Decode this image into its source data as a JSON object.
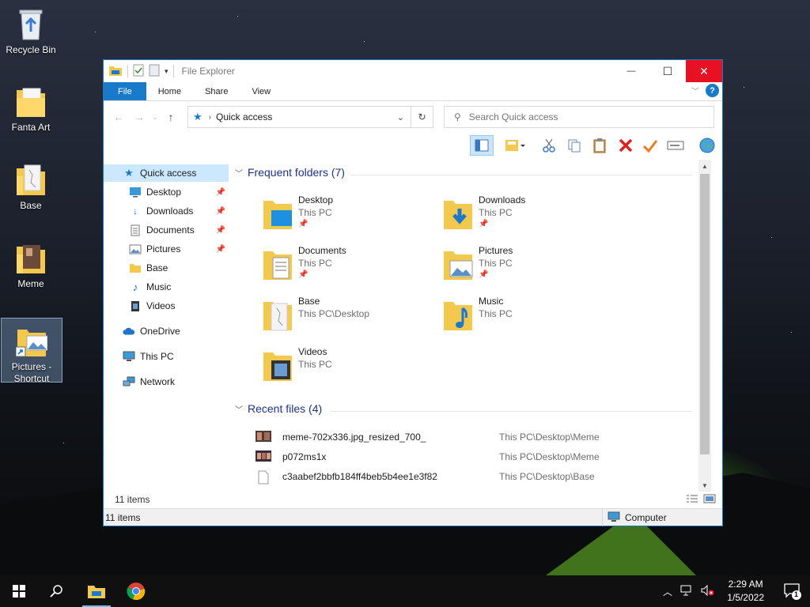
{
  "desktop": {
    "icons": [
      {
        "label": "Recycle Bin"
      },
      {
        "label": "Fanta Art"
      },
      {
        "label": "Base"
      },
      {
        "label": "Meme"
      },
      {
        "label": "Pictures - Shortcut"
      }
    ]
  },
  "window": {
    "title": "File Explorer",
    "controls": {
      "minimize": "—",
      "maximize": "☐",
      "close": "✕"
    }
  },
  "ribbon": {
    "tabs": [
      "File",
      "Home",
      "Share",
      "View"
    ],
    "help": "?"
  },
  "address": {
    "location": "Quick access",
    "search_placeholder": "Search Quick access"
  },
  "nav": {
    "items": [
      {
        "label": "Quick access",
        "icon": "star-icon",
        "selected": true
      },
      {
        "label": "Desktop",
        "icon": "desktop-icon",
        "pinned": true
      },
      {
        "label": "Downloads",
        "icon": "download-icon",
        "pinned": true
      },
      {
        "label": "Documents",
        "icon": "documents-icon",
        "pinned": true
      },
      {
        "label": "Pictures",
        "icon": "pictures-icon",
        "pinned": true
      },
      {
        "label": "Base",
        "icon": "folder-icon"
      },
      {
        "label": "Music",
        "icon": "music-icon"
      },
      {
        "label": "Videos",
        "icon": "videos-icon"
      },
      {
        "label": "OneDrive",
        "icon": "cloud-icon"
      },
      {
        "label": "This PC",
        "icon": "computer-icon"
      },
      {
        "label": "Network",
        "icon": "network-icon"
      }
    ]
  },
  "frequent": {
    "header": "Frequent folders (7)",
    "folders": [
      {
        "name": "Desktop",
        "location": "This PC",
        "pinned": true
      },
      {
        "name": "Downloads",
        "location": "This PC",
        "pinned": true
      },
      {
        "name": "Documents",
        "location": "This PC",
        "pinned": true
      },
      {
        "name": "Pictures",
        "location": "This PC",
        "pinned": true
      },
      {
        "name": "Base",
        "location": "This PC\\Desktop"
      },
      {
        "name": "Music",
        "location": "This PC"
      },
      {
        "name": "Videos",
        "location": "This PC"
      }
    ]
  },
  "recent": {
    "header": "Recent files (4)",
    "files": [
      {
        "name": "meme-702x336.jpg_resized_700_",
        "path": "This PC\\Desktop\\Meme"
      },
      {
        "name": "p072ms1x",
        "path": "This PC\\Desktop\\Meme"
      },
      {
        "name": "c3aabef2bbfb184ff4beb5b4ee1e3f82",
        "path": "This PC\\Desktop\\Base"
      }
    ]
  },
  "status": {
    "item_count": "11 items",
    "bar_count": "11 items",
    "location": "Computer"
  },
  "taskbar": {
    "time": "2:29 AM",
    "date": "1/5/2022",
    "notifications": "1"
  },
  "colors": {
    "accent": "#1979ca",
    "close": "#e81123",
    "section_header": "#1e3287",
    "selection": "#cce8ff"
  }
}
